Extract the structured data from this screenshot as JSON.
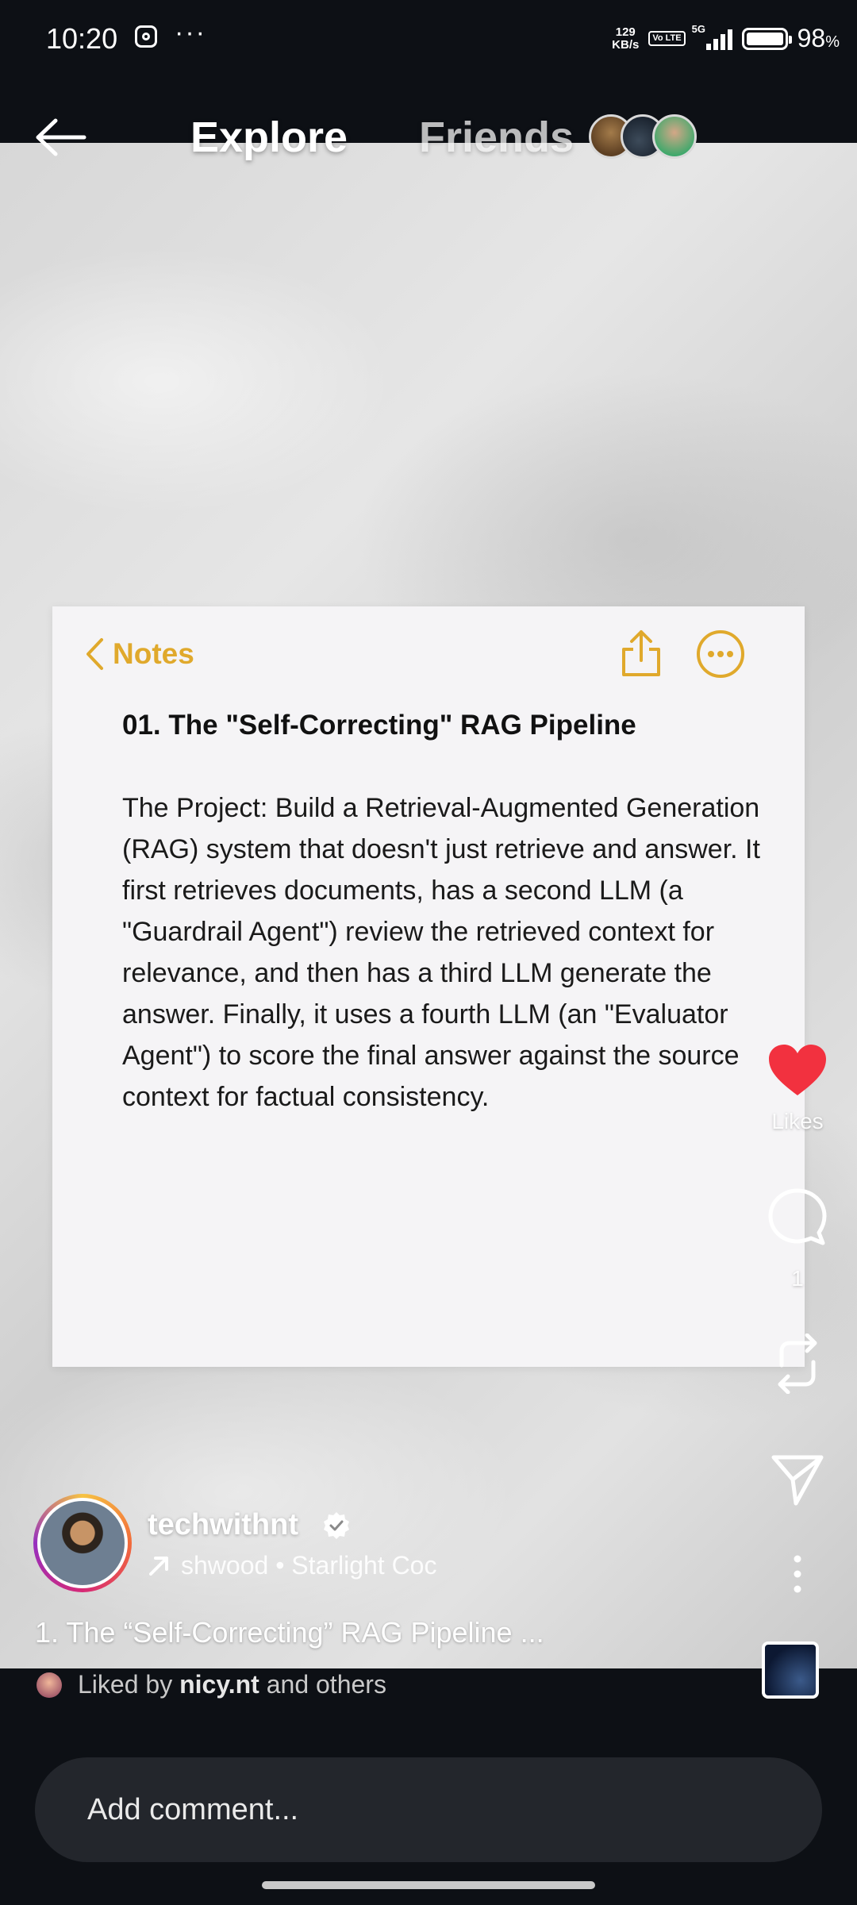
{
  "status_bar": {
    "time": "10:20",
    "more": "···",
    "net_speed_value": "129",
    "net_speed_unit": "KB/s",
    "volte": "Vo LTE",
    "network": "5G",
    "battery": "98",
    "battery_unit": "%"
  },
  "header": {
    "tab_explore": "Explore",
    "tab_friends": "Friends"
  },
  "notes": {
    "back_label": "Notes",
    "title": "01. The \"Self-Correcting\" RAG Pipeline",
    "body": "The Project: Build a Retrieval-Augmented Generation (RAG) system that doesn't just retrieve and answer. It first retrieves documents, has a second LLM (a \"Guardrail Agent\") review the retrieved context for relevance, and then has a third LLM generate the answer. Finally, it uses a fourth LLM (an \"Evaluator Agent\") to score the final answer against the source context for factual consistency.",
    "accent_color": "#e0a92c"
  },
  "actions": {
    "likes_label": "Likes",
    "comments_count": "1",
    "like_color": "#f2313f"
  },
  "author": {
    "username": "techwithnt",
    "music": "shwood • Starlight Coc"
  },
  "caption": "1. The “Self-Correcting” RAG Pipeline ...",
  "liked_by": {
    "prefix": "Liked by",
    "user": "nicy.nt",
    "suffix": "and others"
  },
  "comment": {
    "placeholder": "Add comment..."
  }
}
